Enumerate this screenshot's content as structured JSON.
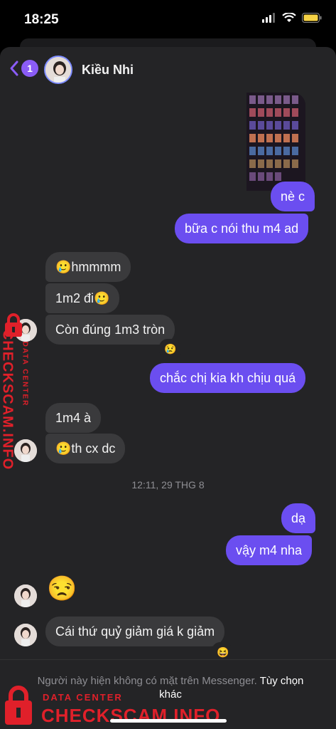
{
  "status": {
    "time": "18:25"
  },
  "header": {
    "back_badge": "1",
    "name": "Kiều Nhi"
  },
  "messages": {
    "m1": "nè c",
    "m2": "bữa c nói thu m4 ad",
    "m3": "🥲hmmmm",
    "m4": "1m2 đi🥲",
    "m5": "Còn đúng 1m3 tròn",
    "m5_reaction": "😢",
    "m6": "chắc chị kia kh chịu quá",
    "m7": "1m4 à",
    "m8": "🥲th cx dc",
    "timestamp": "12:11, 29 THG 8",
    "m9": "dạ",
    "m10": "vậy m4 nha",
    "m11": "😒",
    "m12": "Cái thứ quỷ giảm giá k giảm",
    "m12_reaction": "😆"
  },
  "footer": {
    "notice": "Người này hiện không có mặt trên Messenger.",
    "link": "Tùy chọn khác"
  },
  "watermark": {
    "small": "DATA CENTER",
    "big": "CHECKSCAM.INFO"
  },
  "colors": {
    "outgoing": "#6b4ef0",
    "incoming": "#3a3a3c",
    "accent": "#8a5cf6"
  }
}
